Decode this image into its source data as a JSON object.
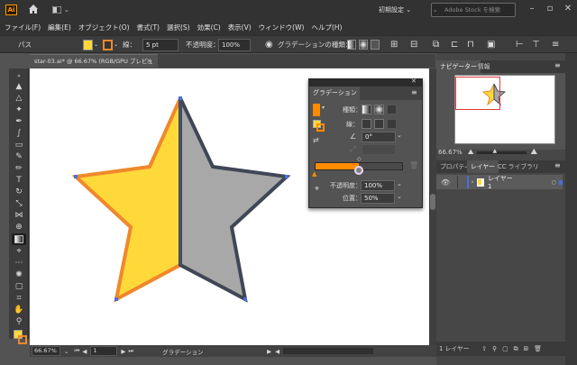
{
  "titlebar": {
    "app_logo": "Ai",
    "workspace": "初期設定",
    "stock_search_placeholder": "Adobe Stock を検索"
  },
  "menu": {
    "items": [
      "ファイル(F)",
      "編集(E)",
      "オブジェクト(O)",
      "書式(T)",
      "選択(S)",
      "効果(C)",
      "表示(V)",
      "ウィンドウ(W)",
      "ヘルプ(H)"
    ]
  },
  "controlbar": {
    "object_type": "パス",
    "stroke_label": "線：",
    "stroke_value": "5 pt",
    "opacity_label": "不透明度：",
    "opacity_value": "100%",
    "gradient_type_label": "グラデーションの種類："
  },
  "document": {
    "tab_title": "star-03.ai* @ 66.67% (RGB/GPU プレビュー)",
    "zoom": "66.67%",
    "artboard_num": "1",
    "status_tool": "グラデーション"
  },
  "gradient_panel": {
    "title": "グラデーション",
    "type_label": "種類：",
    "stroke_label": "線：",
    "angle_value": "0°",
    "opacity_label": "不透明度：",
    "opacity_value": "100%",
    "location_label": "位置：",
    "location_value": "50%"
  },
  "navigator": {
    "tabs": [
      "ナビゲーター",
      "情報"
    ],
    "zoom": "66.67%"
  },
  "layers": {
    "tabs": [
      "プロパティ",
      "レイヤー",
      "CC ライブラリ"
    ],
    "items": [
      {
        "name": "レイヤー 1"
      }
    ],
    "footer_count": "1 レイヤー"
  },
  "colors": {
    "star_left_fill": "#FFD83A",
    "star_left_stroke": "#F0882A",
    "star_right_fill": "#A8A8A8",
    "star_right_stroke": "#3F4756",
    "accent_orange": "#FF8B00"
  }
}
